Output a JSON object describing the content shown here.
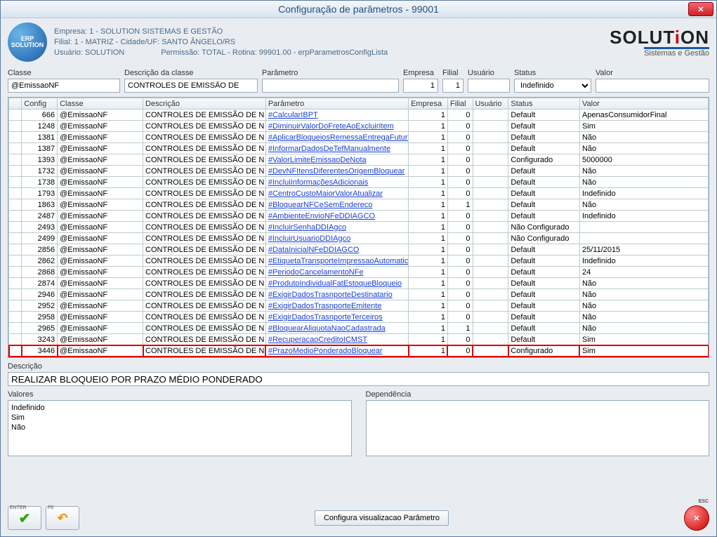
{
  "window": {
    "title": "Configuração de parâmetros - 99001"
  },
  "header": {
    "line1": "Empresa: 1 - SOLUTION SISTEMAS E GESTÃO",
    "line2": "Filial: 1 - MATRIZ - Cidade/UF: SANTO ÂNGELO/RS",
    "line3_user": "Usuário: SOLUTION",
    "line3_perm": "Permissão: TOTAL - Rotina: 99901.00 - erpParametrosConfigLista",
    "brand_sub": "Sistemas e Gestão"
  },
  "filters": {
    "classe": {
      "label": "Classe",
      "value": "@EmissaoNF"
    },
    "desc_classe": {
      "label": "Descrição da classe",
      "value": "CONTROLES DE EMISSÃO DE"
    },
    "parametro": {
      "label": "Parâmetro",
      "value": ""
    },
    "empresa": {
      "label": "Empresa",
      "value": "1"
    },
    "filial": {
      "label": "Filial",
      "value": "1"
    },
    "usuario": {
      "label": "Usuário",
      "value": ""
    },
    "status": {
      "label": "Status",
      "value": "Indefinido"
    },
    "valor": {
      "label": "Valor",
      "value": ""
    }
  },
  "grid": {
    "headers": {
      "config": "Config",
      "classe": "Classe",
      "descricao": "Descrição",
      "parametro": "Parâmetro",
      "empresa": "Empresa",
      "filial": "Filial",
      "usuario": "Usuário",
      "status": "Status",
      "valor": "Valor"
    },
    "rows": [
      {
        "config": "666",
        "classe": "@EmissaoNF",
        "desc": "CONTROLES DE EMISSÃO DE N",
        "param": "#CalcularIBPT",
        "emp": "1",
        "fil": "0",
        "usr": "",
        "status": "Default",
        "valor": "ApenasConsumidorFinal"
      },
      {
        "config": "1248",
        "classe": "@EmissaoNF",
        "desc": "CONTROLES DE EMISSÃO DE N",
        "param": "#DiminuirValorDoFreteAoExcluirItem",
        "emp": "1",
        "fil": "0",
        "usr": "",
        "status": "Default",
        "valor": "Sim"
      },
      {
        "config": "1381",
        "classe": "@EmissaoNF",
        "desc": "CONTROLES DE EMISSÃO DE N",
        "param": "#AplicarBloqueiosRemessaEntregaFutura",
        "emp": "1",
        "fil": "0",
        "usr": "",
        "status": "Default",
        "valor": "Não"
      },
      {
        "config": "1387",
        "classe": "@EmissaoNF",
        "desc": "CONTROLES DE EMISSÃO DE N",
        "param": "#InformarDadosDeTefManualmente",
        "emp": "1",
        "fil": "0",
        "usr": "",
        "status": "Default",
        "valor": "Não"
      },
      {
        "config": "1393",
        "classe": "@EmissaoNF",
        "desc": "CONTROLES DE EMISSÃO DE N",
        "param": "#ValorLimiteEmissaoDeNota",
        "emp": "1",
        "fil": "0",
        "usr": "",
        "status": "Configurado",
        "valor": "5000000"
      },
      {
        "config": "1732",
        "classe": "@EmissaoNF",
        "desc": "CONTROLES DE EMISSÃO DE N",
        "param": "#DevNFItensDiferentesOrigemBloquear",
        "emp": "1",
        "fil": "0",
        "usr": "",
        "status": "Default",
        "valor": "Não"
      },
      {
        "config": "1738",
        "classe": "@EmissaoNF",
        "desc": "CONTROLES DE EMISSÃO DE N",
        "param": "#IncluiInformaçõesAdicionais",
        "emp": "1",
        "fil": "0",
        "usr": "",
        "status": "Default",
        "valor": "Não"
      },
      {
        "config": "1793",
        "classe": "@EmissaoNF",
        "desc": "CONTROLES DE EMISSÃO DE N",
        "param": "#CentroCustoMaiorValorAtualizar",
        "emp": "1",
        "fil": "0",
        "usr": "",
        "status": "Default",
        "valor": "Indefinido"
      },
      {
        "config": "1863",
        "classe": "@EmissaoNF",
        "desc": "CONTROLES DE EMISSÃO DE N",
        "param": "#BloquearNFCeSemEndereco",
        "emp": "1",
        "fil": "1",
        "usr": "",
        "status": "Default",
        "valor": "Não"
      },
      {
        "config": "2487",
        "classe": "@EmissaoNF",
        "desc": "CONTROLES DE EMISSÃO DE N",
        "param": "#AmbienteEnvioNFeDDIAGCO",
        "emp": "1",
        "fil": "0",
        "usr": "",
        "status": "Default",
        "valor": "Indefinido"
      },
      {
        "config": "2493",
        "classe": "@EmissaoNF",
        "desc": "CONTROLES DE EMISSÃO DE N",
        "param": "#IncluirSenhaDDIAgco",
        "emp": "1",
        "fil": "0",
        "usr": "",
        "status": "Não Configurado",
        "valor": ""
      },
      {
        "config": "2499",
        "classe": "@EmissaoNF",
        "desc": "CONTROLES DE EMISSÃO DE N",
        "param": "#IncluirUsuarioDDIAgco",
        "emp": "1",
        "fil": "0",
        "usr": "",
        "status": "Não Configurado",
        "valor": ""
      },
      {
        "config": "2856",
        "classe": "@EmissaoNF",
        "desc": "CONTROLES DE EMISSÃO DE N",
        "param": "#DataInicialNFeDDIAGCO",
        "emp": "1",
        "fil": "0",
        "usr": "",
        "status": "Default",
        "valor": "25/11/2015"
      },
      {
        "config": "2862",
        "classe": "@EmissaoNF",
        "desc": "CONTROLES DE EMISSÃO DE N",
        "param": "#EtiquetaTransporteImpressaoAutomatica",
        "emp": "1",
        "fil": "0",
        "usr": "",
        "status": "Default",
        "valor": "Indefinido"
      },
      {
        "config": "2868",
        "classe": "@EmissaoNF",
        "desc": "CONTROLES DE EMISSÃO DE N",
        "param": "#PeriodoCancelamentoNFe",
        "emp": "1",
        "fil": "0",
        "usr": "",
        "status": "Default",
        "valor": "24"
      },
      {
        "config": "2874",
        "classe": "@EmissaoNF",
        "desc": "CONTROLES DE EMISSÃO DE N",
        "param": "#ProdutoIndividualFatEstoqueBloqueio",
        "emp": "1",
        "fil": "0",
        "usr": "",
        "status": "Default",
        "valor": "Não"
      },
      {
        "config": "2946",
        "classe": "@EmissaoNF",
        "desc": "CONTROLES DE EMISSÃO DE N",
        "param": "#ExigirDadosTrasnporteDestinatario",
        "emp": "1",
        "fil": "0",
        "usr": "",
        "status": "Default",
        "valor": "Não"
      },
      {
        "config": "2952",
        "classe": "@EmissaoNF",
        "desc": "CONTROLES DE EMISSÃO DE N",
        "param": "#ExigirDadosTrasnporteEmitente",
        "emp": "1",
        "fil": "0",
        "usr": "",
        "status": "Default",
        "valor": "Não"
      },
      {
        "config": "2958",
        "classe": "@EmissaoNF",
        "desc": "CONTROLES DE EMISSÃO DE N",
        "param": "#ExigirDadosTrasnporteTerceiros",
        "emp": "1",
        "fil": "0",
        "usr": "",
        "status": "Default",
        "valor": "Não"
      },
      {
        "config": "2965",
        "classe": "@EmissaoNF",
        "desc": "CONTROLES DE EMISSÃO DE N",
        "param": "#BloquearAliquotaNaoCadastrada",
        "emp": "1",
        "fil": "1",
        "usr": "",
        "status": "Default",
        "valor": "Não"
      },
      {
        "config": "3243",
        "classe": "@EmissaoNF",
        "desc": "CONTROLES DE EMISSÃO DE N",
        "param": "#RecuperacaoCreditoICMST",
        "emp": "1",
        "fil": "0",
        "usr": "",
        "status": "Default",
        "valor": "Sim"
      },
      {
        "config": "3446",
        "classe": "@EmissaoNF",
        "desc": "CONTROLES DE EMISSÃO DE N",
        "param": "#PrazoMedioPonderadoBloquear",
        "emp": "1",
        "fil": "0",
        "usr": "",
        "status": "Configurado",
        "valor": "Sim",
        "highlight": true
      }
    ]
  },
  "detail": {
    "descricao_label": "Descrição",
    "descricao_value": "REALIZAR BLOQUEIO POR PRAZO MÉDIO PONDERADO",
    "valores_label": "Valores",
    "valores": [
      "Indefinido",
      "Sim",
      "Não"
    ],
    "dependencia_label": "Dependência"
  },
  "footer": {
    "enter_tag": "ENTER",
    "f6_tag": "F6",
    "center_btn": "Configura visualizacao Parâmetro",
    "esc_tag": "ESC"
  }
}
